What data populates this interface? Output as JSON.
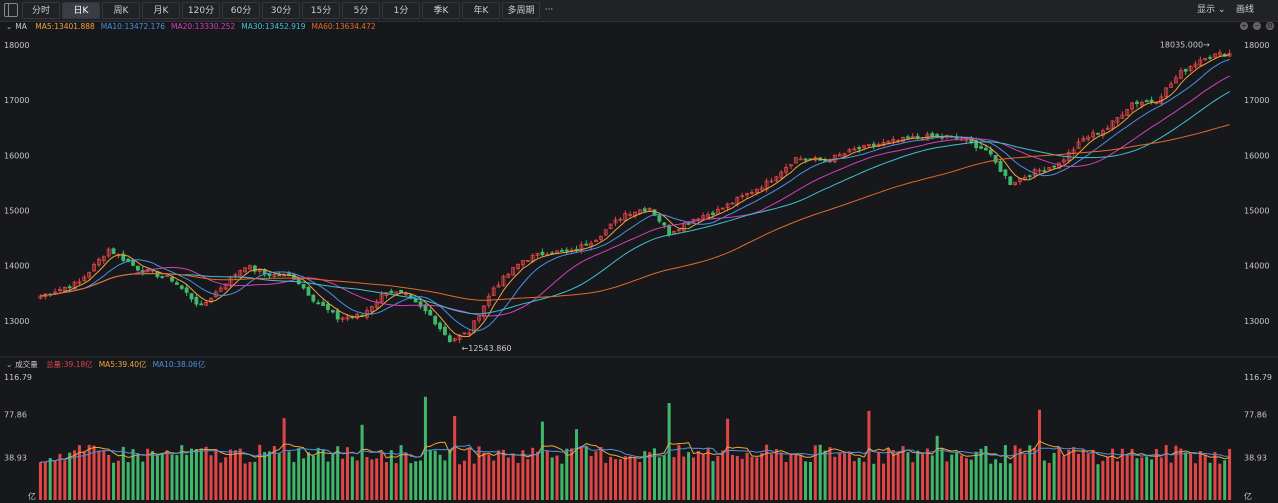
{
  "toolbar": {
    "tabs": [
      {
        "label": "分时",
        "active": false
      },
      {
        "label": "日K",
        "active": true
      },
      {
        "label": "周K",
        "active": false
      },
      {
        "label": "月K",
        "active": false
      },
      {
        "label": "120分",
        "active": false
      },
      {
        "label": "60分",
        "active": false
      },
      {
        "label": "30分",
        "active": false
      },
      {
        "label": "15分",
        "active": false
      },
      {
        "label": "5分",
        "active": false
      },
      {
        "label": "1分",
        "active": false
      },
      {
        "label": "季K",
        "active": false
      },
      {
        "label": "年K",
        "active": false
      },
      {
        "label": "多周期",
        "active": false
      }
    ],
    "more_label": "···",
    "display_label": "显示",
    "draw_label": "画线"
  },
  "price_legend": {
    "name": "MA",
    "items": [
      {
        "label": "MA5:13401.888",
        "color": "#f0a53c"
      },
      {
        "label": "MA10:13472.176",
        "color": "#4a90e2"
      },
      {
        "label": "MA20:13330.252",
        "color": "#d63fb8"
      },
      {
        "label": "MA30:13452.919",
        "color": "#3fc1d0"
      },
      {
        "label": "MA60:13634.472",
        "color": "#e06a2a"
      }
    ]
  },
  "volume_legend": {
    "name": "成交量",
    "items": [
      {
        "label": "总量:39.18亿",
        "color": "#e04646"
      },
      {
        "label": "MA5:39.40亿",
        "color": "#f0a53c"
      },
      {
        "label": "MA10:38.06亿",
        "color": "#4a90e2"
      }
    ]
  },
  "colors": {
    "up": "#e04646",
    "down": "#3fb86a"
  },
  "chart_data": {
    "type": "candlestick",
    "price_axis": {
      "ticks": [
        13000,
        14000,
        15000,
        16000,
        17000,
        18000
      ],
      "range": [
        12400,
        18200
      ]
    },
    "volume_axis": {
      "ticks": [
        "116.79",
        "77.86",
        "38.93"
      ],
      "unit": "亿",
      "range": [
        0,
        116.79
      ]
    },
    "annotations": {
      "high": "18035.000→",
      "low": "←12543.860"
    },
    "close_anchors": [
      [
        0,
        13450
      ],
      [
        8,
        13700
      ],
      [
        14,
        14300
      ],
      [
        20,
        13950
      ],
      [
        27,
        13750
      ],
      [
        33,
        13250
      ],
      [
        38,
        13700
      ],
      [
        42,
        14000
      ],
      [
        46,
        13850
      ],
      [
        52,
        13800
      ],
      [
        56,
        13400
      ],
      [
        61,
        13050
      ],
      [
        66,
        13100
      ],
      [
        71,
        13550
      ],
      [
        75,
        13450
      ],
      [
        80,
        13100
      ],
      [
        84,
        12650
      ],
      [
        88,
        12800
      ],
      [
        93,
        13600
      ],
      [
        99,
        14100
      ],
      [
        104,
        14250
      ],
      [
        109,
        14250
      ],
      [
        114,
        14500
      ],
      [
        120,
        14950
      ],
      [
        125,
        15050
      ],
      [
        129,
        14600
      ],
      [
        134,
        14850
      ],
      [
        139,
        15000
      ],
      [
        144,
        15250
      ],
      [
        149,
        15500
      ],
      [
        155,
        15950
      ],
      [
        161,
        15900
      ],
      [
        167,
        16100
      ],
      [
        172,
        16200
      ],
      [
        178,
        16300
      ],
      [
        183,
        16350
      ],
      [
        189,
        16300
      ],
      [
        194,
        16100
      ],
      [
        199,
        15500
      ],
      [
        204,
        15700
      ],
      [
        209,
        15850
      ],
      [
        214,
        16300
      ],
      [
        219,
        16500
      ],
      [
        224,
        16950
      ],
      [
        229,
        17000
      ],
      [
        234,
        17500
      ],
      [
        239,
        17800
      ],
      [
        244,
        17850
      ]
    ]
  }
}
